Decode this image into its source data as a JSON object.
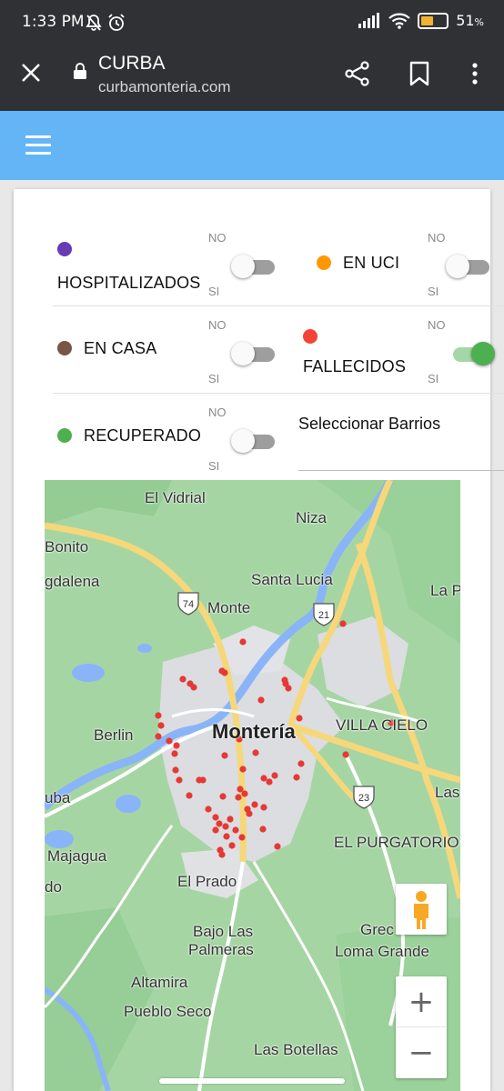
{
  "status_bar": {
    "time": "1:33 PM",
    "left_icons": [
      "mute-icon",
      "alarm-icon"
    ],
    "battery_percent": "51",
    "battery_unit": "%",
    "battery_level": 0.51
  },
  "browser": {
    "title": "CURBA",
    "url": "curbamonteria.com"
  },
  "filters": [
    {
      "label": "HOSPITALIZADOS",
      "color": "#673ab7",
      "no": "NO",
      "si": "SI",
      "on": false
    },
    {
      "label": "EN UCI",
      "color": "#ff9800",
      "no": "NO",
      "si": "SI",
      "on": false
    },
    {
      "label": "EN CASA",
      "color": "#795548",
      "no": "NO",
      "si": "SI",
      "on": false
    },
    {
      "label": "FALLECIDOS",
      "color": "#f44336",
      "no": "NO",
      "si": "SI",
      "on": true
    },
    {
      "label": "RECUPERADO",
      "color": "#4caf50",
      "no": "NO",
      "si": "SI",
      "on": false
    }
  ],
  "select_barrios": "Seleccionar Barrios",
  "map": {
    "places": {
      "el_vidrial": "El Vidrial",
      "niza": "Niza",
      "bonito": "Bonito",
      "gdalena": "gdalena",
      "santa_lucia": "Santa Lucia",
      "la_p": "La P",
      "monte": "Monte",
      "berlin": "Berlin",
      "monteria": "Montería",
      "villa_cielo": "VILLA CIELO",
      "uba": "uba",
      "las": "Las",
      "majagua": "Majagua",
      "el_purgatorio": "EL PURGATORIO",
      "do": "do",
      "el_prado": "El Prado",
      "bajo_las_palmeras_1": "Bajo Las",
      "bajo_las_palmeras_2": "Palmeras",
      "grec": "Grec",
      "loma_grande": "Loma Grande",
      "altamira": "Altamira",
      "pueblo_seco": "Pueblo Seco",
      "las_botellas": "Las Botellas"
    },
    "route_shields": [
      "74",
      "21",
      "23"
    ],
    "zoom_in": "+",
    "zoom_out": "−",
    "marker_color": "#e53935"
  }
}
